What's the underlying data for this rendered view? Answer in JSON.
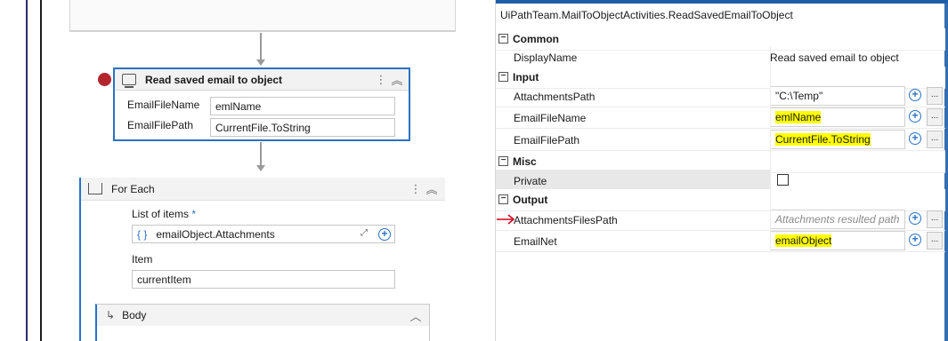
{
  "designer": {
    "activity": {
      "title": "Read saved email to object",
      "args": [
        {
          "label": "EmailFileName",
          "value": "emlName"
        },
        {
          "label": "EmailFilePath",
          "value": "CurrentFile.ToString"
        }
      ]
    },
    "foreach": {
      "title": "For Each",
      "list_label": "List of items",
      "required_mark": "*",
      "list_value": "emailObject.Attachments",
      "brace": "{ }",
      "item_label": "Item",
      "item_value": "currentItem",
      "body_title": "Body"
    }
  },
  "properties": {
    "type_name": "UiPathTeam.MailToObjectActivities.ReadSavedEmailToObject",
    "categories": {
      "common": "Common",
      "input": "Input",
      "misc": "Misc",
      "output": "Output"
    },
    "rows": {
      "display_name": {
        "label": "DisplayName",
        "value": "Read saved email to object"
      },
      "attachments_path": {
        "label": "AttachmentsPath",
        "value": "\"C:\\Temp\""
      },
      "email_file_name": {
        "label": "EmailFileName",
        "value": "emlName"
      },
      "email_file_path": {
        "label": "EmailFilePath",
        "value": "CurrentFile.ToString"
      },
      "private": {
        "label": "Private",
        "checked": false
      },
      "attachments_files_path": {
        "label": "AttachmentsFilesPath",
        "placeholder": "Attachments resulted path"
      },
      "email_net": {
        "label": "EmailNet",
        "value": "emailObject"
      }
    },
    "more_label": "...",
    "plus_glyph": "+",
    "collapse_glyph": "−"
  },
  "colors": {
    "accent": "#2a72c4",
    "highlight": "#ffff00",
    "breakpoint": "#b3262e",
    "annotation_arrow": "#d0021b"
  }
}
